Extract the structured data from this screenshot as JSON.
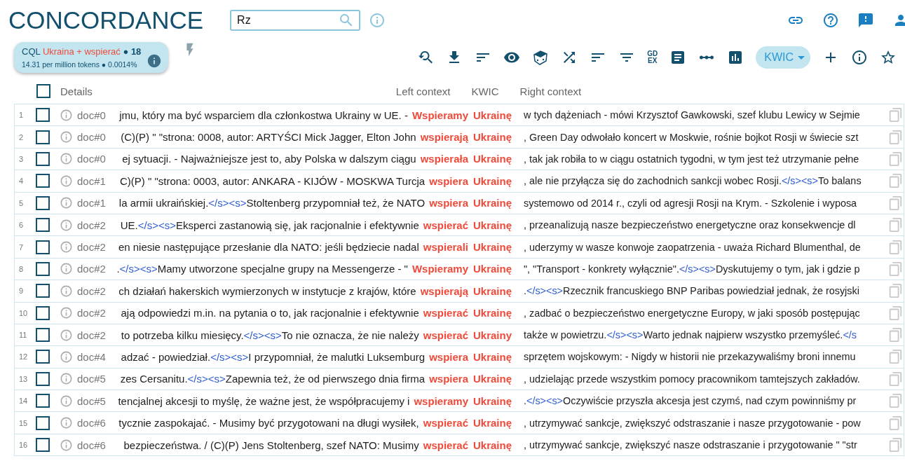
{
  "title": "CONCORDANCE",
  "search": {
    "value": "Rz"
  },
  "query": {
    "label": "CQL",
    "query": "Ukraina + wspierać",
    "separator": "●",
    "count": "18",
    "stats": "14.31 per million tokens ● 0.0014%"
  },
  "toolbar": {
    "gdex": [
      "GD",
      "EX"
    ],
    "view": "KWIC"
  },
  "header": {
    "select_all": {
      "checked": false
    },
    "details": "Details",
    "left": "Left context",
    "kwic": "KWIC",
    "right": "Right context"
  },
  "rows": [
    {
      "num": "1",
      "doc": "doc#0",
      "checked": false,
      "left": [
        {
          "kind": "text",
          "text": "jmu, który ma być wsparciem dla członkostwa Ukrainy w UE. -"
        }
      ],
      "kwic": [
        "Wspieramy",
        "Ukrainę"
      ],
      "right": [
        {
          "kind": "text",
          "text": "w tych dążeniach - mówi Krzysztof Gawkowski, szef klubu Lewicy w Sejmie"
        }
      ]
    },
    {
      "num": "2",
      "doc": "doc#0",
      "checked": false,
      "left": [
        {
          "kind": "text",
          "text": "(C)(P) \" \"strona: 0008, autor: ARTYŚCI Mick Jagger, Elton John"
        }
      ],
      "kwic": [
        "wspierają",
        "Ukrainę"
      ],
      "right": [
        {
          "kind": "text",
          "text": ", Green Day odwołało koncert w Moskwie, rośnie bojkot Rosji w świecie szt"
        }
      ]
    },
    {
      "num": "3",
      "doc": "doc#0",
      "checked": false,
      "left": [
        {
          "kind": "text",
          "text": "ej sytuacji. - Najważniejsze jest to, aby Polska w dalszym ciągu"
        }
      ],
      "kwic": [
        "wspierała",
        "Ukrainę"
      ],
      "right": [
        {
          "kind": "text",
          "text": ", tak jak robiła to w ciągu ostatnich tygodni, w tym jest też utrzymanie pełne"
        }
      ]
    },
    {
      "num": "4",
      "doc": "doc#1",
      "checked": false,
      "left": [
        {
          "kind": "text",
          "text": "C)(P) \" \"strona: 0003, autor: ANKARA - KIJÓW - MOSKWA Turcja"
        }
      ],
      "kwic": [
        "wspiera",
        "Ukrainę"
      ],
      "right": [
        {
          "kind": "text",
          "text": ", ale nie przyłącza się do zachodnich sankcji wobec Rosji."
        },
        {
          "kind": "tag",
          "text": "</s><s>"
        },
        {
          "kind": "text",
          "text": "To balans"
        }
      ]
    },
    {
      "num": "5",
      "doc": "doc#1",
      "checked": false,
      "left": [
        {
          "kind": "text",
          "text": "la armii ukraińskiej."
        },
        {
          "kind": "tag",
          "text": "</s><s>"
        },
        {
          "kind": "text",
          "text": "Stoltenberg przypomniał też, że NATO"
        }
      ],
      "kwic": [
        "wspiera",
        "Ukrainę"
      ],
      "right": [
        {
          "kind": "text",
          "text": "systemowo od 2014 r., czyli od agresji Rosji na Krym. - Szkolenie i wyposa"
        }
      ]
    },
    {
      "num": "6",
      "doc": "doc#2",
      "checked": false,
      "left": [
        {
          "kind": "text",
          "text": "UE."
        },
        {
          "kind": "tag",
          "text": "</s><s>"
        },
        {
          "kind": "text",
          "text": "Eksperci zastanowią się, jak racjonalnie i efektywnie"
        }
      ],
      "kwic": [
        "wspierać",
        "Ukrainę"
      ],
      "right": [
        {
          "kind": "text",
          "text": ", przeanalizują nasze bezpieczeństwo energetyczne oraz konsekwencje dl"
        }
      ]
    },
    {
      "num": "7",
      "doc": "doc#2",
      "checked": false,
      "left": [
        {
          "kind": "text",
          "text": "en niesie następujące przesłanie dla NATO: jeśli będziecie nadal"
        }
      ],
      "kwic": [
        "wspierali",
        "Ukrainę"
      ],
      "right": [
        {
          "kind": "text",
          "text": ", uderzymy w wasze konwoje zaopatrzenia - uważa Richard Blumenthal, de"
        }
      ]
    },
    {
      "num": "8",
      "doc": "doc#2",
      "checked": false,
      "left": [
        {
          "kind": "text",
          "text": "."
        },
        {
          "kind": "tag",
          "text": "</s><s>"
        },
        {
          "kind": "text",
          "text": "Mamy utworzone specjalne grupy na Messengerze - \""
        }
      ],
      "kwic": [
        "Wspieramy",
        "Ukrainę"
      ],
      "right": [
        {
          "kind": "text",
          "text": "\", \"Transport - konkrety wyłącznie\"."
        },
        {
          "kind": "tag",
          "text": "</s><s>"
        },
        {
          "kind": "text",
          "text": "Dyskutujemy o tym, jak i gdzie p"
        }
      ]
    },
    {
      "num": "9",
      "doc": "doc#2",
      "checked": false,
      "left": [
        {
          "kind": "text",
          "text": "ch działań hakerskich wymierzonych w instytucje z krajów, które"
        }
      ],
      "kwic": [
        "wspierają",
        "Ukrainę"
      ],
      "right": [
        {
          "kind": "text",
          "text": "."
        },
        {
          "kind": "tag",
          "text": "</s><s>"
        },
        {
          "kind": "text",
          "text": "Rzecznik francuskiego BNP Paribas powiedział jednak, że rosyjski"
        }
      ]
    },
    {
      "num": "10",
      "doc": "doc#2",
      "checked": false,
      "left": [
        {
          "kind": "text",
          "text": "ają odpowiedzi m.in. na pytania o to, jak racjonalnie i efektywnie"
        }
      ],
      "kwic": [
        "wspierać",
        "Ukrainę"
      ],
      "right": [
        {
          "kind": "text",
          "text": ", zadbać o bezpieczeństwo energetyczne Europy, w jaki sposób postępując"
        }
      ]
    },
    {
      "num": "11",
      "doc": "doc#2",
      "checked": false,
      "left": [
        {
          "kind": "text",
          "text": "to potrzeba kilku miesięcy."
        },
        {
          "kind": "tag",
          "text": "</s><s>"
        },
        {
          "kind": "text",
          "text": "To nie oznacza, że nie należy"
        }
      ],
      "kwic": [
        "wspierać",
        "Ukrainy"
      ],
      "right": [
        {
          "kind": "text",
          "text": "także w powietrzu."
        },
        {
          "kind": "tag",
          "text": "</s><s>"
        },
        {
          "kind": "text",
          "text": "Warto jednak najpierw wszystko przemyśleć."
        },
        {
          "kind": "tag",
          "text": "</s"
        }
      ]
    },
    {
      "num": "12",
      "doc": "doc#4",
      "checked": false,
      "left": [
        {
          "kind": "text",
          "text": "adzać - powiedział."
        },
        {
          "kind": "tag",
          "text": "</s><s>"
        },
        {
          "kind": "text",
          "text": "I przypomniał, że malutki Luksemburg"
        }
      ],
      "kwic": [
        "wspiera",
        "Ukrainę"
      ],
      "right": [
        {
          "kind": "text",
          "text": "sprzętem wojskowym: - Nigdy w historii nie przekazywaliśmy broni innemu"
        }
      ]
    },
    {
      "num": "13",
      "doc": "doc#5",
      "checked": false,
      "left": [
        {
          "kind": "text",
          "text": "zes Cersanitu."
        },
        {
          "kind": "tag",
          "text": "</s><s>"
        },
        {
          "kind": "text",
          "text": "Zapewnia też, że od pierwszego dnia firma"
        }
      ],
      "kwic": [
        "wspiera",
        "Ukrainę"
      ],
      "right": [
        {
          "kind": "text",
          "text": ", udzielając przede wszystkim pomocy pracownikom tamtejszych zakładów."
        }
      ]
    },
    {
      "num": "14",
      "doc": "doc#5",
      "checked": false,
      "left": [
        {
          "kind": "text",
          "text": "tencjalnej akcesji to myślę, że ważne jest, że współpracujemy i"
        }
      ],
      "kwic": [
        "wspieramy",
        "Ukrainę"
      ],
      "right": [
        {
          "kind": "text",
          "text": "."
        },
        {
          "kind": "tag",
          "text": "</s><s>"
        },
        {
          "kind": "text",
          "text": "Oczywiście przyszła akcesja jest czymś, nad czym powinniśmy pr"
        }
      ]
    },
    {
      "num": "15",
      "doc": "doc#6",
      "checked": false,
      "left": [
        {
          "kind": "text",
          "text": "tycznie zaspokajać. - Musimy być przygotowani na długi wysiłek,"
        }
      ],
      "kwic": [
        "wspierać",
        "Ukrainę"
      ],
      "right": [
        {
          "kind": "text",
          "text": ", utrzymywać sankcje, zwiększyć odstraszanie i nasze przygotowanie - pow"
        }
      ]
    },
    {
      "num": "16",
      "doc": "doc#6",
      "checked": false,
      "left": [
        {
          "kind": "text",
          "text": "bezpieczeństwa. / (C)(P) Jens Stoltenberg, szef NATO: Musimy"
        }
      ],
      "kwic": [
        "wspierać",
        "Ukrainę"
      ],
      "right": [
        {
          "kind": "text",
          "text": ", utrzymywać sankcje, zwiększyć nasze odstraszanie i przygotowanie \" \"str"
        }
      ]
    }
  ]
}
